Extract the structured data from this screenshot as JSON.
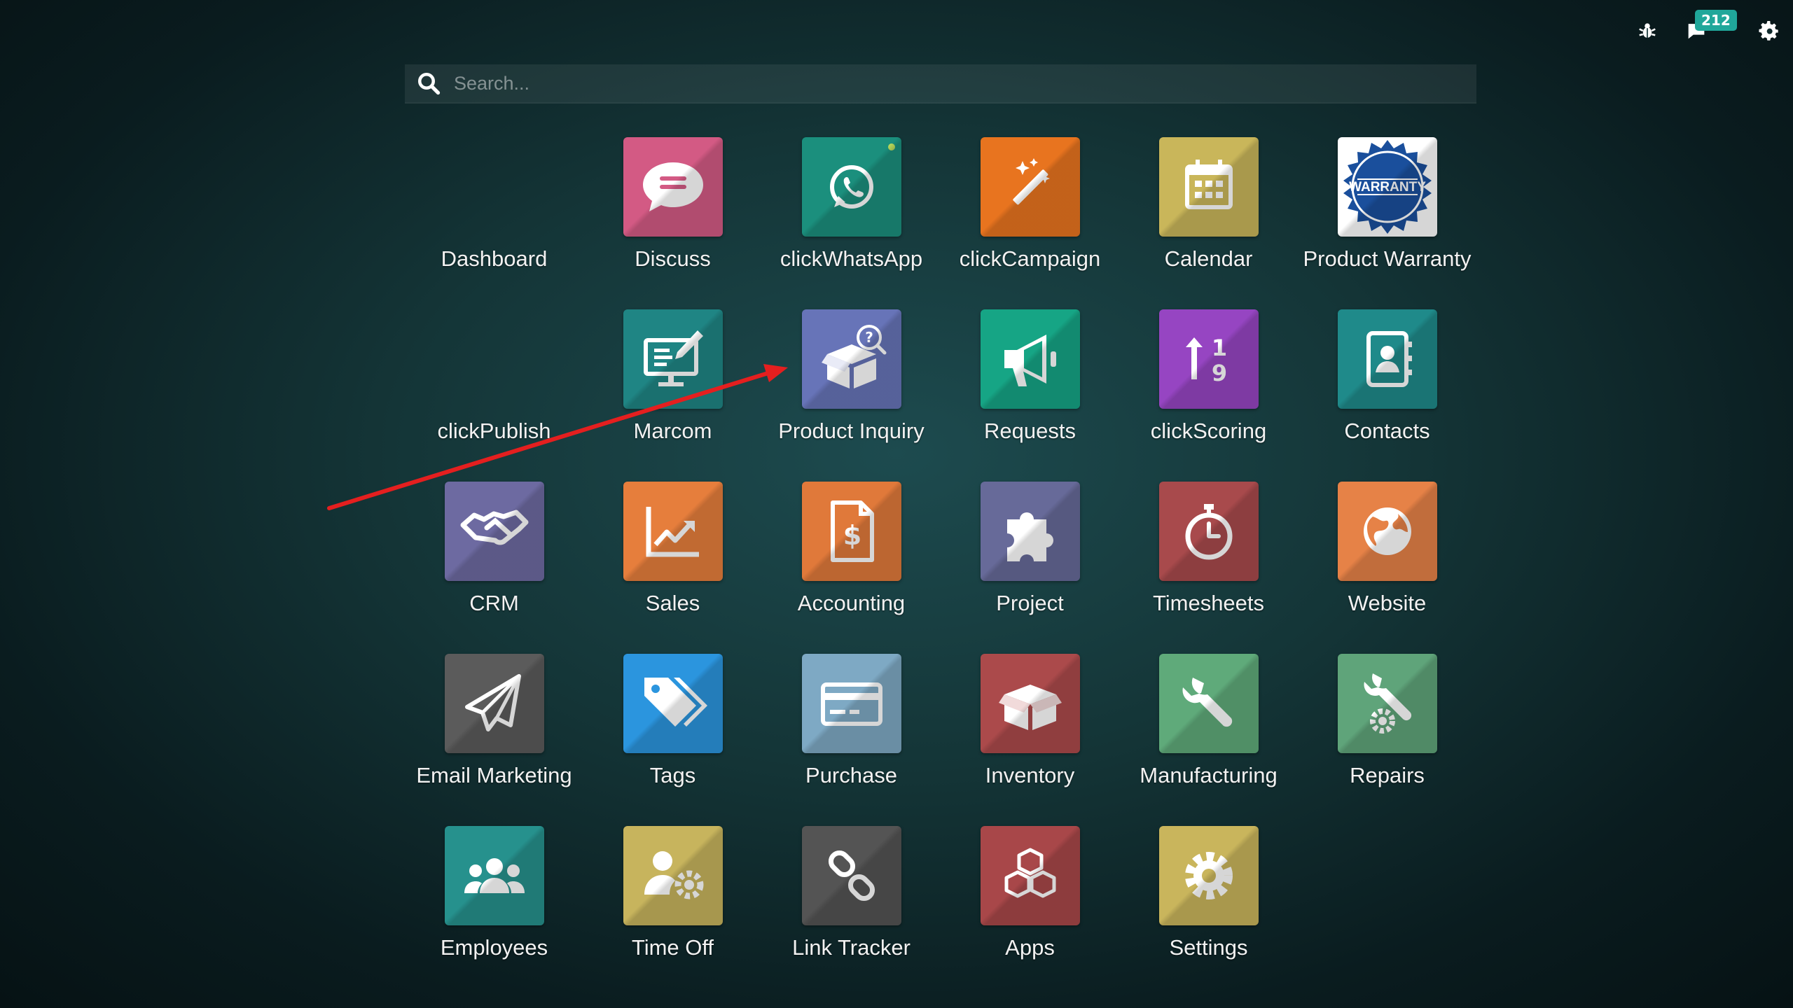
{
  "topbar": {
    "bug_icon": "bug-icon",
    "chat_icon": "chat-icon",
    "chat_count": "212",
    "settings_icon": "gear-icon"
  },
  "search": {
    "placeholder": "Search...",
    "value": ""
  },
  "apps": [
    {
      "label": "Dashboard",
      "icon": "none",
      "color": ""
    },
    {
      "label": "Discuss",
      "icon": "chat-bubble-icon",
      "color": "#d35a84"
    },
    {
      "label": "clickWhatsApp",
      "icon": "whatsapp-icon",
      "color": "#1b8f7d"
    },
    {
      "label": "clickCampaign",
      "icon": "magic-wand-icon",
      "color": "#e8741f"
    },
    {
      "label": "Calendar",
      "icon": "calendar-icon",
      "color": "#c9b65a"
    },
    {
      "label": "Product Warranty",
      "icon": "warranty-seal-icon",
      "color": "#ffffff"
    },
    {
      "label": "clickPublish",
      "icon": "none",
      "color": ""
    },
    {
      "label": "Marcom",
      "icon": "monitor-pen-icon",
      "color": "#1f8584"
    },
    {
      "label": "Product Inquiry",
      "icon": "box-question-icon",
      "color": "#6774b8"
    },
    {
      "label": "Requests",
      "icon": "megaphone-icon",
      "color": "#16a585"
    },
    {
      "label": "clickScoring",
      "icon": "sort-numeric-icon",
      "color": "#9645c2"
    },
    {
      "label": "Contacts",
      "icon": "address-book-icon",
      "color": "#1f8a8a"
    },
    {
      "label": "CRM",
      "icon": "handshake-icon",
      "color": "#6d6aa1"
    },
    {
      "label": "Sales",
      "icon": "chart-line-icon",
      "color": "#e67e3c"
    },
    {
      "label": "Accounting",
      "icon": "invoice-dollar-icon",
      "color": "#e0793a"
    },
    {
      "label": "Project",
      "icon": "puzzle-icon",
      "color": "#676a99"
    },
    {
      "label": "Timesheets",
      "icon": "stopwatch-icon",
      "color": "#a84a4c"
    },
    {
      "label": "Website",
      "icon": "globe-icon",
      "color": "#e68247"
    },
    {
      "label": "Email Marketing",
      "icon": "paper-plane-icon",
      "color": "#5b5b5b"
    },
    {
      "label": "Tags",
      "icon": "tags-icon",
      "color": "#2b95de"
    },
    {
      "label": "Purchase",
      "icon": "credit-card-icon",
      "color": "#7ea9c4"
    },
    {
      "label": "Inventory",
      "icon": "open-box-icon",
      "color": "#ab4a4b"
    },
    {
      "label": "Manufacturing",
      "icon": "wrench-icon",
      "color": "#5faa7a"
    },
    {
      "label": "Repairs",
      "icon": "wrench-gear-icon",
      "color": "#5fa47a"
    },
    {
      "label": "Employees",
      "icon": "users-icon",
      "color": "#26918d"
    },
    {
      "label": "Time Off",
      "icon": "user-gear-icon",
      "color": "#c7b45d"
    },
    {
      "label": "Link Tracker",
      "icon": "link-icon",
      "color": "#545454"
    },
    {
      "label": "Apps",
      "icon": "cubes-icon",
      "color": "#a84749"
    },
    {
      "label": "Settings",
      "icon": "gear-icon",
      "color": "#c9b55c"
    }
  ],
  "warranty_text": "WARRANTY"
}
